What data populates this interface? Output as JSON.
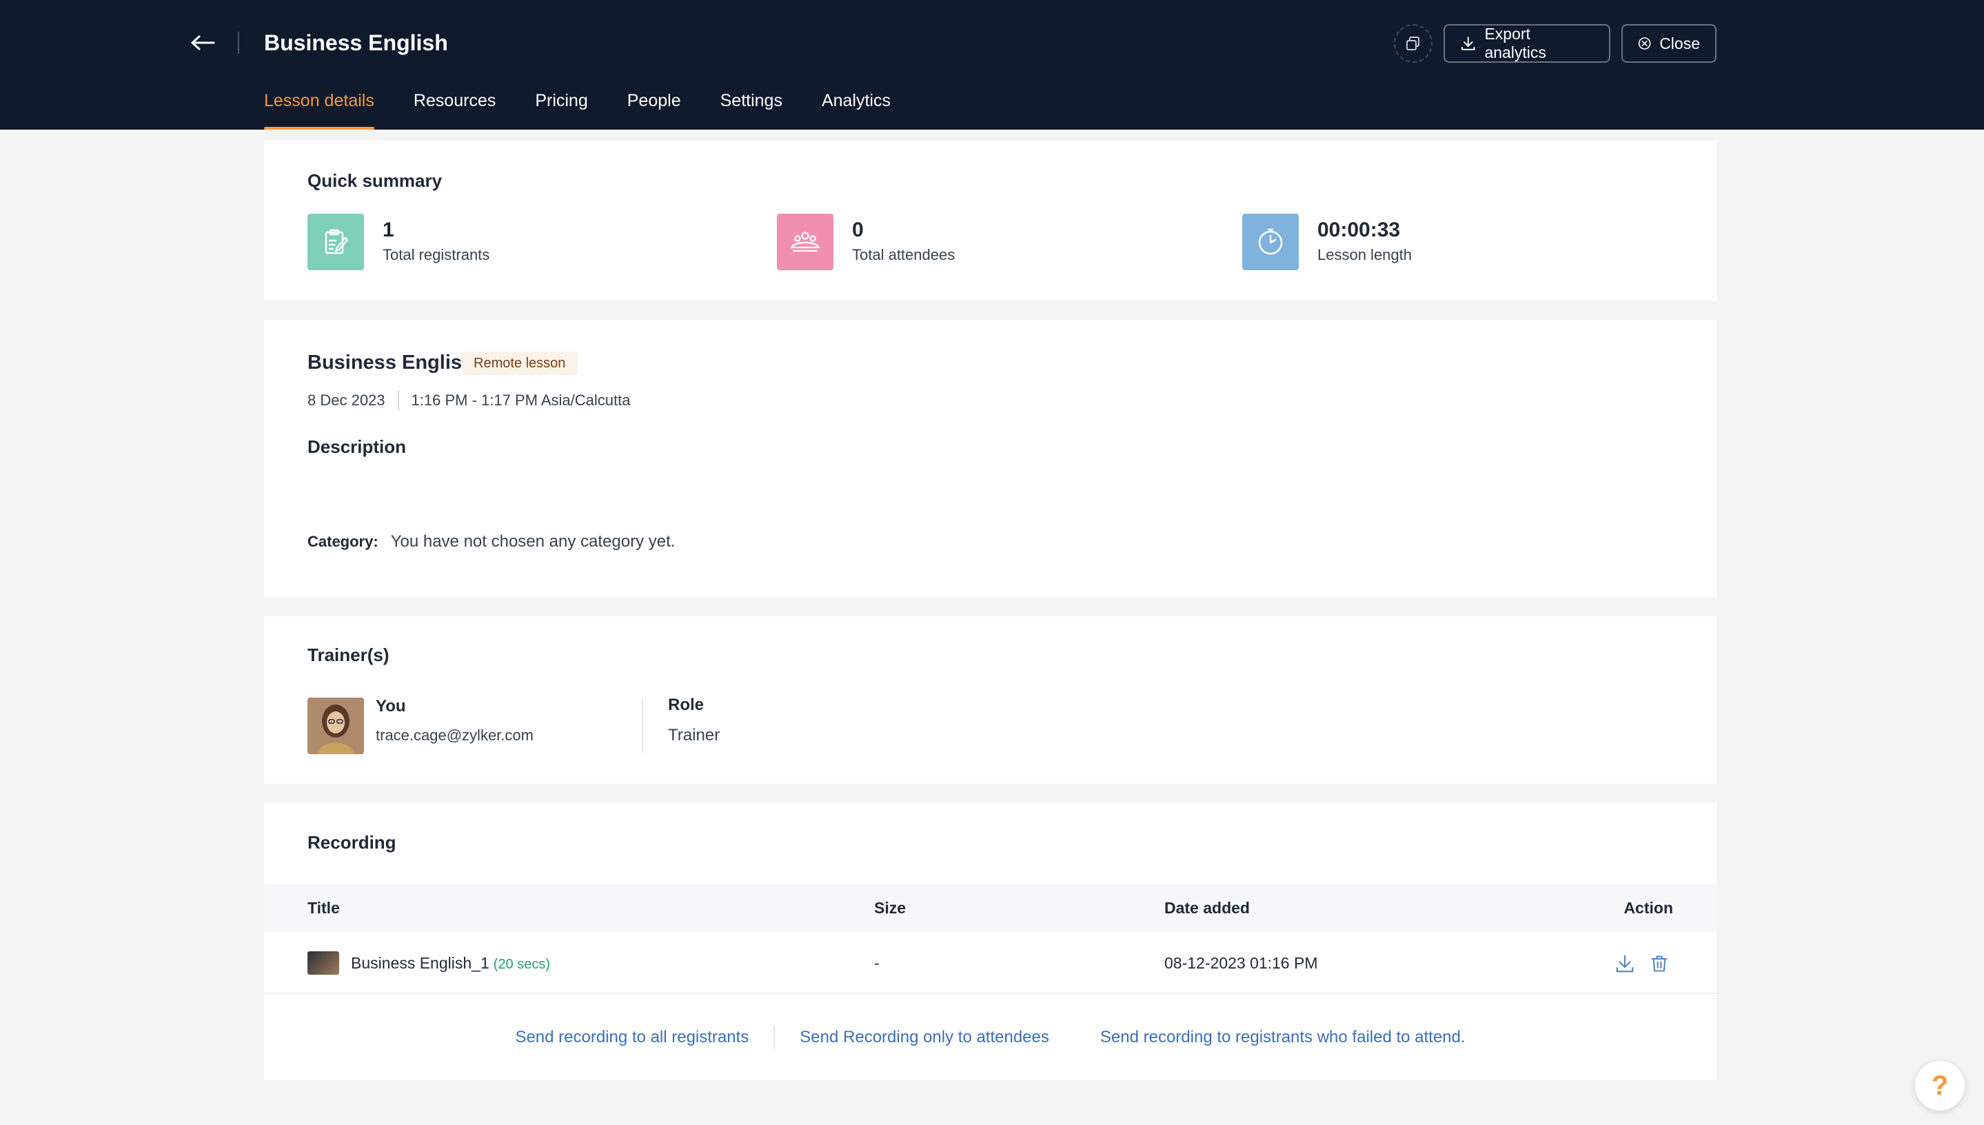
{
  "header": {
    "title": "Business English",
    "export_label": "Export analytics",
    "close_label": "Close",
    "tabs": [
      {
        "label": "Lesson details"
      },
      {
        "label": "Resources"
      },
      {
        "label": "Pricing"
      },
      {
        "label": "People"
      },
      {
        "label": "Settings"
      },
      {
        "label": "Analytics"
      }
    ],
    "active_tab": "Lesson details"
  },
  "summary": {
    "title": "Quick summary",
    "stats": [
      {
        "value": "1",
        "label": "Total registrants",
        "icon": "registrants-clipboard-icon",
        "color": "#7fd0b9"
      },
      {
        "value": "0",
        "label": "Total attendees",
        "icon": "attendees-group-icon",
        "color": "#f18fb0"
      },
      {
        "value": "00:00:33",
        "label": "Lesson length",
        "icon": "clock-icon",
        "color": "#7fb2dd"
      }
    ]
  },
  "lesson": {
    "name": "Business English",
    "badge": "Remote lesson",
    "date": "8 Dec 2023",
    "time": "1:16 PM - 1:17 PM Asia/Calcutta",
    "description_title": "Description",
    "category_label": "Category:",
    "category_value": "You have not chosen any category yet."
  },
  "trainers": {
    "title": "Trainer(s)",
    "name": "You",
    "email": "trace.cage@zylker.com",
    "role_label": "Role",
    "role_value": "Trainer"
  },
  "recording": {
    "title": "Recording",
    "columns": [
      "Title",
      "Size",
      "Date added",
      "Action"
    ],
    "rows": [
      {
        "title": "Business English_1",
        "duration": "(20 secs)",
        "size": "-",
        "date_added": "08-12-2023 01:16 PM"
      }
    ],
    "send_links": [
      "Send recording to all registrants",
      "Send Recording only to attendees",
      "Send recording to registrants who failed to attend."
    ]
  },
  "help_label": "?",
  "colors": {
    "header_bg": "#0f1a2c",
    "accent": "#f59a3c",
    "link": "#3b6fb6",
    "duration_green": "#22a06b"
  }
}
